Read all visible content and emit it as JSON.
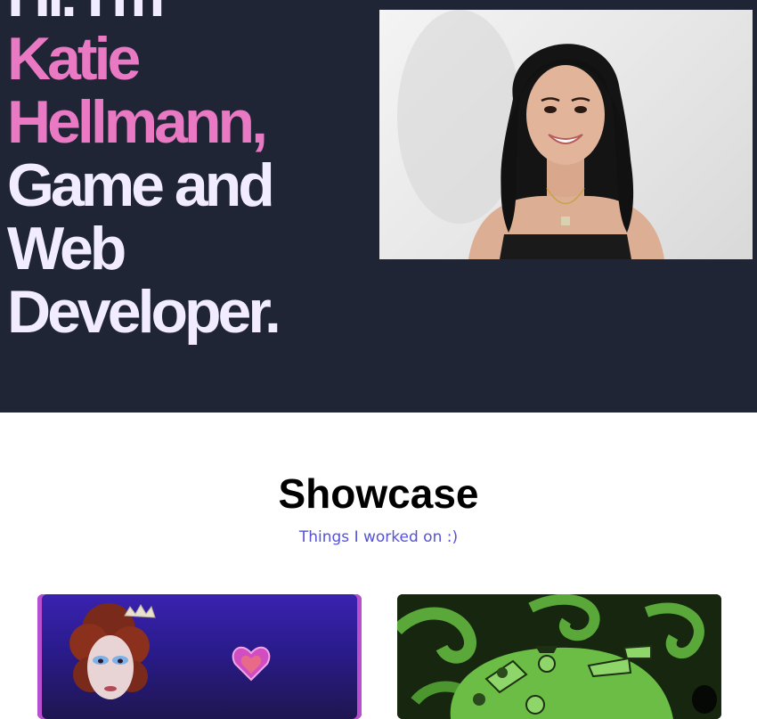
{
  "hero": {
    "heading_lines": [
      {
        "text": "Hi. I'm",
        "tone": "white"
      },
      {
        "text": "Katie",
        "tone": "pink"
      },
      {
        "text": "Hellmann,",
        "tone": "pink"
      },
      {
        "text": "Game and",
        "tone": "white"
      },
      {
        "text": "Web",
        "tone": "white"
      },
      {
        "text": "Developer.",
        "tone": "white"
      }
    ],
    "photo_alt": "Portrait photo of Katie Hellmann"
  },
  "showcase": {
    "title": "Showcase",
    "subtitle": "Things I worked on :)",
    "cards": [
      {
        "alt": "Project thumbnail: portrait with crown and heart"
      },
      {
        "alt": "Project thumbnail: green swirl game art"
      }
    ]
  },
  "colors": {
    "background_dark": "#1f2535",
    "accent_pink": "#e879c2",
    "heading_white": "#f1ecff",
    "subtitle_purple": "#5552d8"
  }
}
